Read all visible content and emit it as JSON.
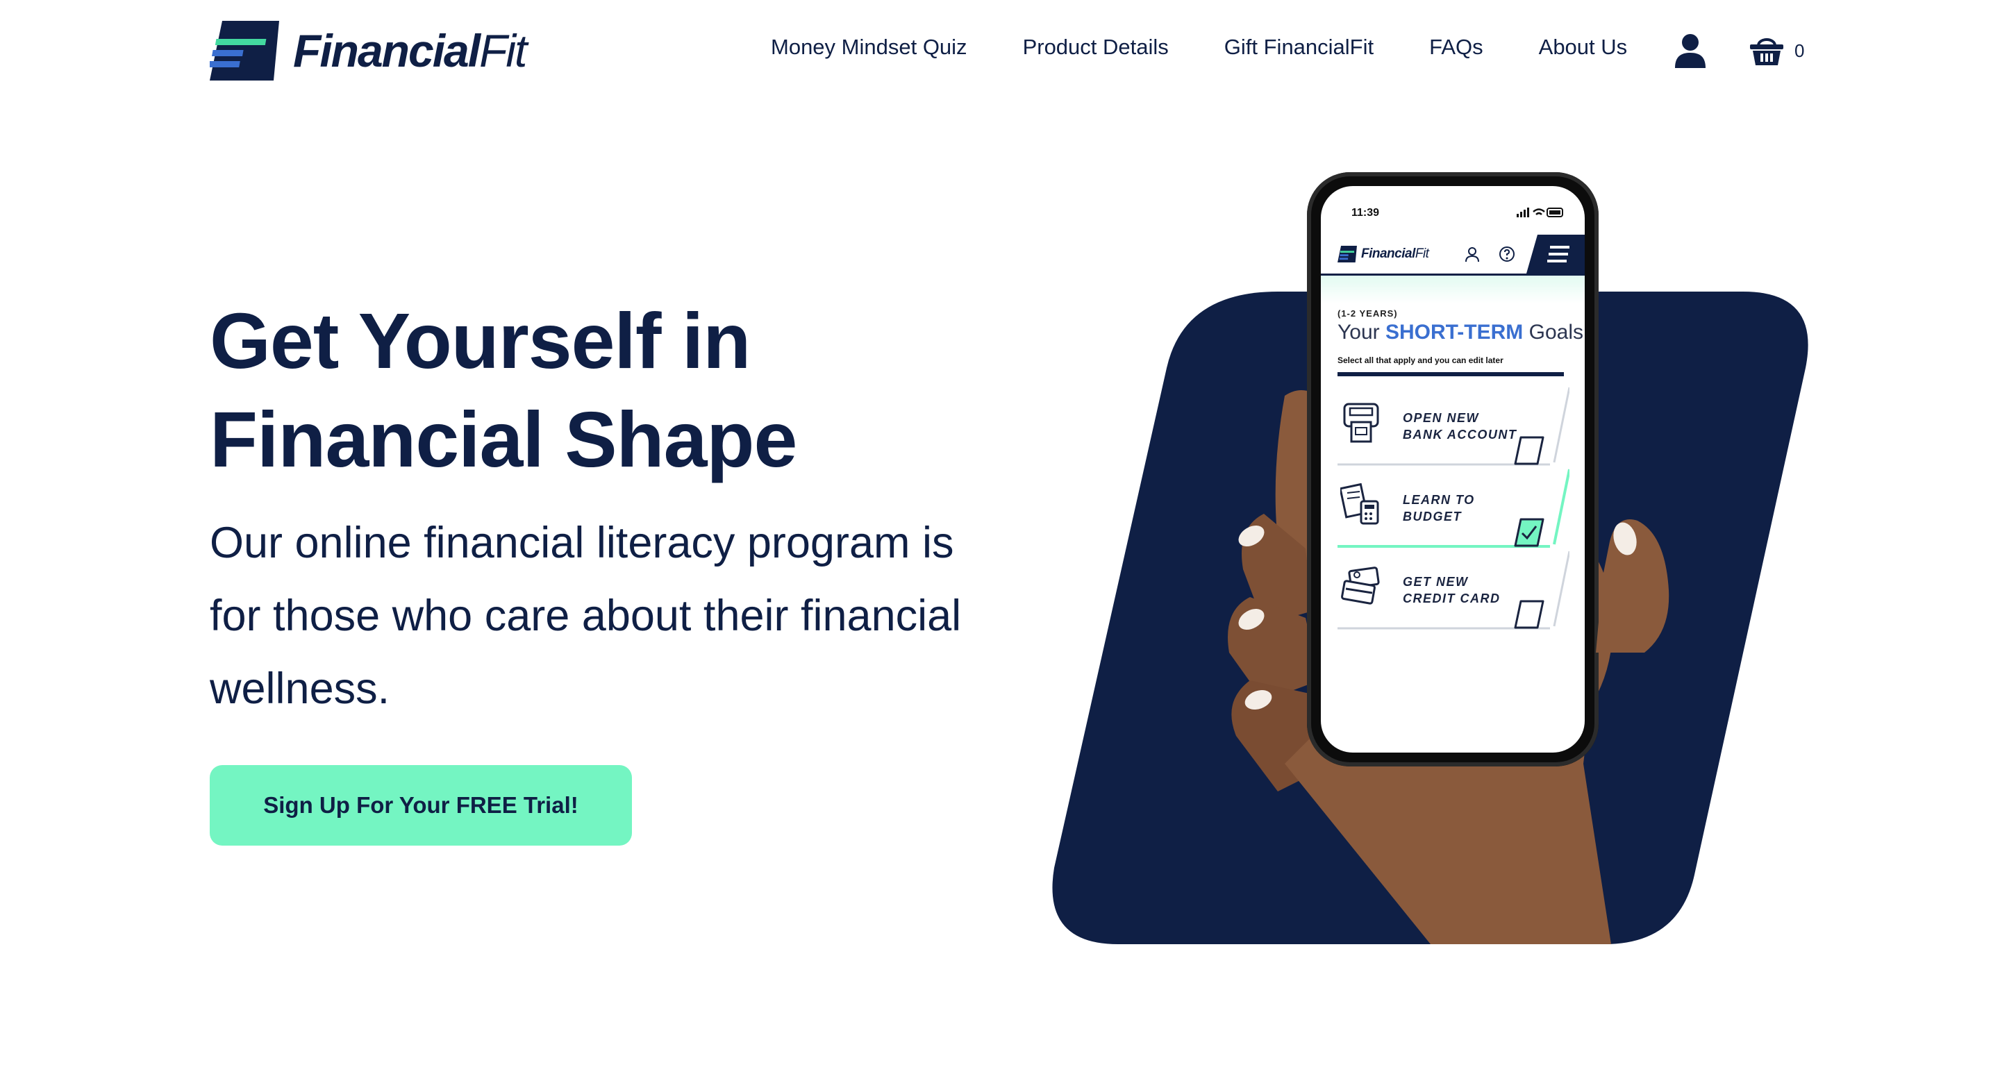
{
  "brand": {
    "name": "FinancialFit",
    "logo_name_part1": "Financial",
    "logo_name_part2": "Fit",
    "colors": {
      "navy": "#0f1f45",
      "mint": "#74f5c2",
      "blue": "#3a6fd0",
      "green_stripe": "#43d9a0"
    }
  },
  "nav": {
    "items": [
      {
        "label": "Money Mindset Quiz"
      },
      {
        "label": "Product Details"
      },
      {
        "label": "Gift FinancialFit"
      },
      {
        "label": "FAQs"
      },
      {
        "label": "About Us"
      }
    ],
    "account_icon": "user-icon",
    "cart_icon": "basket-icon",
    "cart_count": "0"
  },
  "hero": {
    "title_line1": "Get Yourself in",
    "title_line2": "Financial Shape",
    "subtitle": "Our online financial literacy program is for those who care about their financial wellness.",
    "cta_label": "Sign Up For Your FREE Trial!"
  },
  "phone": {
    "time": "11:39",
    "app_name_part1": "Financial",
    "app_name_part2": "Fit",
    "goals_years": "(1-2 YEARS)",
    "goals_title_prefix": "Your ",
    "goals_title_highlight": "SHORT-TERM",
    "goals_title_suffix": " Goals",
    "goals_hint": "Select all that apply and you can edit later",
    "goals": [
      {
        "label": "OPEN NEW\nBANK ACCOUNT",
        "icon": "atm-icon",
        "checked": false
      },
      {
        "label": "LEARN TO\nBUDGET",
        "icon": "budget-icon",
        "checked": true
      },
      {
        "label": "GET NEW\nCREDIT CARD",
        "icon": "credit-card-icon",
        "checked": false
      }
    ]
  }
}
